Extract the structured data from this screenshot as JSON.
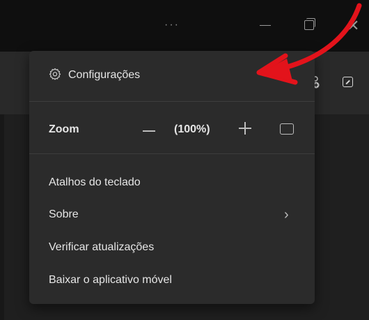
{
  "titlebar": {
    "more_label": "···"
  },
  "menu": {
    "settings_label": "Configurações",
    "zoom_label": "Zoom",
    "zoom_value": "(100%)",
    "items": [
      {
        "label": "Atalhos do teclado"
      },
      {
        "label": "Sobre"
      },
      {
        "label": "Verificar atualizações"
      },
      {
        "label": "Baixar o aplicativo móvel"
      }
    ]
  },
  "annotation": {
    "color": "#e3131b"
  }
}
